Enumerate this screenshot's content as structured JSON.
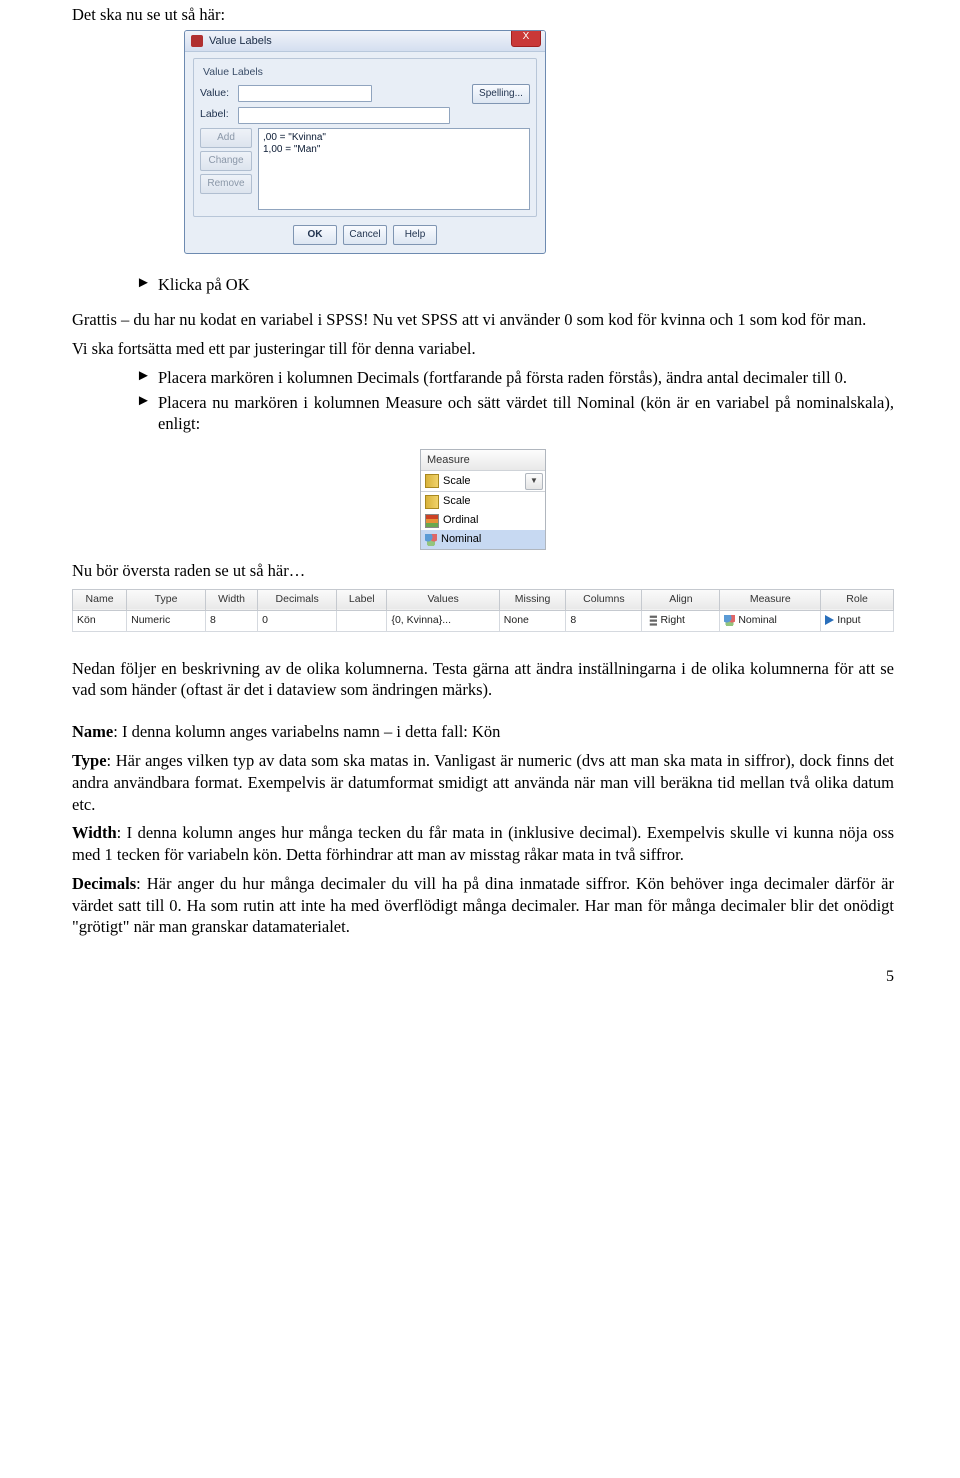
{
  "intro_line": "Det ska nu se ut så här:",
  "dlg": {
    "title": "Value Labels",
    "fieldset_title": "Value Labels",
    "value_lbl": "Value:",
    "label_lbl": "Label:",
    "spelling_btn": "Spelling...",
    "add_btn": "Add",
    "change_btn": "Change",
    "remove_btn": "Remove",
    "list_item1": ",00 = \"Kvinna\"",
    "list_item2": "1,00 = \"Man\"",
    "ok_btn": "OK",
    "cancel_btn": "Cancel",
    "help_btn": "Help",
    "close_glyph": "X"
  },
  "bullet_click_ok": "Klicka på OK",
  "para_grattis": "Grattis – du har nu kodat en variabel i SPSS! Nu vet SPSS att vi använder 0 som kod för kvinna och 1 som kod för man.",
  "para_fortsatt": "Vi ska fortsätta med ett par justeringar till för denna variabel.",
  "bullet_decimals": "Placera markören i kolumnen Decimals (fortfarande på första raden förstås), ändra antal decimaler till 0.",
  "bullet_measure": "Placera nu markören i kolumnen Measure och sätt värdet till Nominal (kön är en variabel på nominalskala), enligt:",
  "measure": {
    "header": "Measure",
    "selected": "Scale",
    "opt1": "Scale",
    "opt2": "Ordinal",
    "opt3": "Nominal"
  },
  "para_oversta": "Nu bör översta raden se ut så här…",
  "vv": {
    "headers": [
      "Name",
      "Type",
      "Width",
      "Decimals",
      "Label",
      "Values",
      "Missing",
      "Columns",
      "Align",
      "Measure",
      "Role"
    ],
    "row": {
      "name": "Kön",
      "type": "Numeric",
      "width": "8",
      "decimals": "0",
      "label": "",
      "values": "{0, Kvinna}...",
      "missing": "None",
      "columns": "8",
      "align": "Right",
      "measure": "Nominal",
      "role": "Input"
    }
  },
  "para_nedan": "Nedan följer en beskrivning av de olika kolumnerna. Testa gärna att ändra inställningarna i de olika kolumnerna för att se vad som händer (oftast är det i dataview som ändringen märks).",
  "defs": {
    "name_term": "Name",
    "name_text": ": I denna kolumn anges variabelns namn – i detta fall: Kön",
    "type_term": "Type",
    "type_text": ": Här anges vilken typ av data som ska matas in. Vanligast är numeric (dvs att man ska mata in siffror), dock finns det andra användbara format. Exempelvis är datumformat smidigt att använda när man vill beräkna tid mellan två olika datum etc.",
    "width_term": "Width",
    "width_text": ": I denna kolumn anges hur många tecken du får mata in (inklusive decimal). Exempelvis skulle vi kunna nöja oss med 1 tecken för variabeln kön. Detta förhindrar att man av misstag råkar mata in två siffror.",
    "dec_term": "Decimals",
    "dec_text": ": Här anger du hur många decimaler du vill ha på dina inmatade siffror. Kön behöver inga decimaler därför är värdet satt till 0. Ha som rutin att inte ha med överflödigt många decimaler. Har man för många decimaler blir det onödigt \"grötigt\" när man granskar datamaterialet."
  },
  "page_number": "5"
}
